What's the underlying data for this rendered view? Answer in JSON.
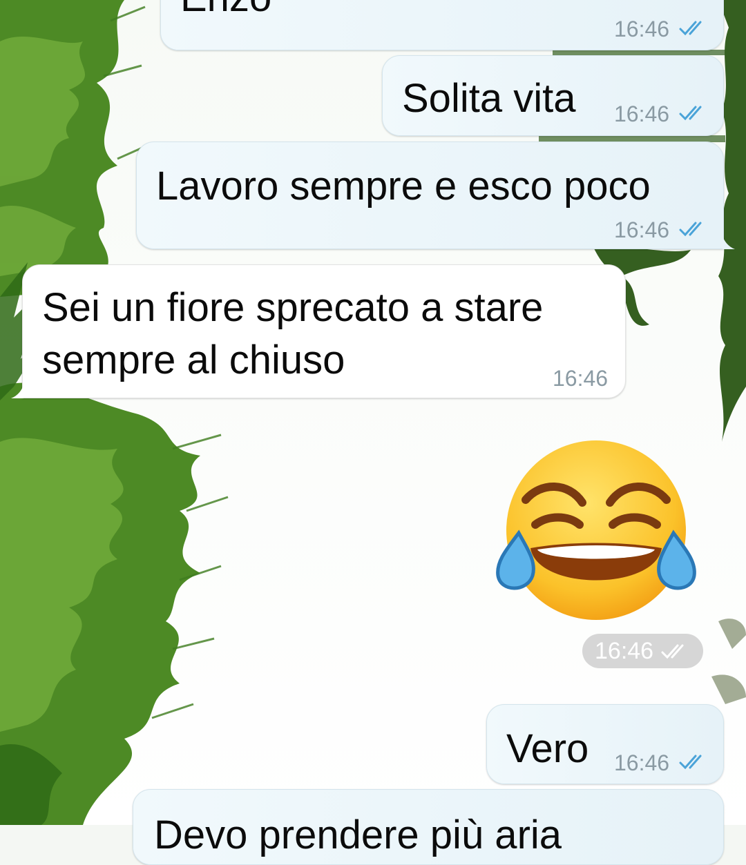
{
  "chat": {
    "messages": [
      {
        "direction": "out",
        "text": "Enzo",
        "time": "16:46",
        "status": "read-double-check-icon"
      },
      {
        "direction": "out",
        "text": "Solita vita",
        "time": "16:46",
        "status": "read-double-check-icon"
      },
      {
        "direction": "out",
        "text": "Lavoro sempre e esco poco",
        "time": "16:46",
        "status": "read-double-check-icon"
      },
      {
        "direction": "in",
        "lines": [
          "Sei un fiore sprecato a stare",
          "sempre al chiuso"
        ],
        "time": "16:46"
      },
      {
        "direction": "out",
        "type": "emoji",
        "emoji": "face-with-tears-of-joy-icon",
        "time": "16:46",
        "status": "read-double-check-icon"
      },
      {
        "direction": "out",
        "text": "Vero",
        "time": "16:46",
        "status": "read-double-check-icon"
      },
      {
        "direction": "out",
        "text": "Devo prendere più aria",
        "partial": true
      }
    ]
  },
  "colors": {
    "outgoing_bubble": "#e6f2f8",
    "incoming_bubble": "#ffffff",
    "read_check": "#4aa3d8",
    "foliage": "#3f7d1f"
  }
}
